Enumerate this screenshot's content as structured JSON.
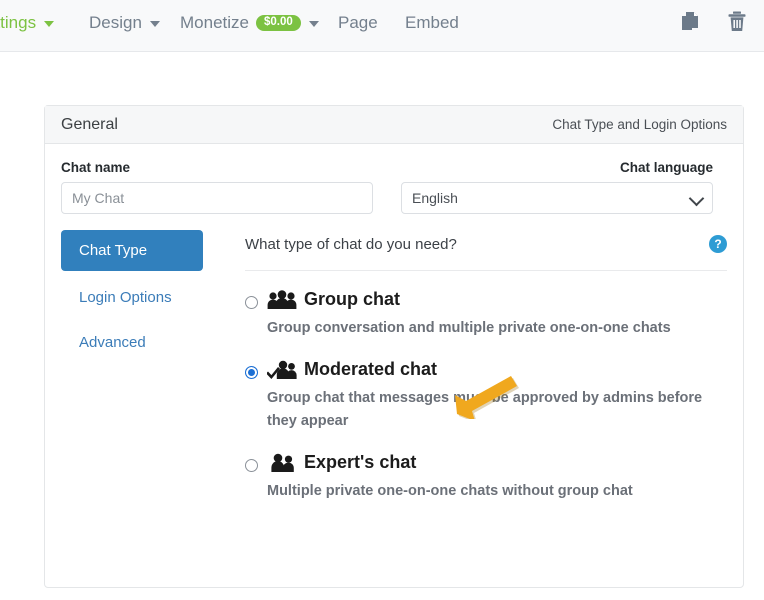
{
  "toolbar": {
    "items": [
      {
        "label": "ettings",
        "icon": "chevron-down-icon",
        "color": "#7cc242"
      },
      {
        "label": "Design",
        "icon": "chevron-down-icon",
        "color": "#74808d"
      },
      {
        "label": "Monetize",
        "badge": "$0.00",
        "badge_color": "#7cc242",
        "icon": "chevron-down-icon",
        "color": "#74808d"
      },
      {
        "label": "Page",
        "color": "#74808d"
      },
      {
        "label": "Embed",
        "color": "#74808d"
      }
    ],
    "actions": [
      {
        "name": "duplicate-icon",
        "title": "Duplicate"
      },
      {
        "name": "trash-icon",
        "title": "Delete"
      }
    ]
  },
  "card": {
    "header": {
      "title": "General",
      "subtitle": "Chat Type and Login Options"
    },
    "chat_name": {
      "label": "Chat name",
      "value": "",
      "placeholder": "My Chat"
    },
    "chat_language": {
      "label": "Chat language",
      "value": "English",
      "options": [
        "English"
      ]
    },
    "nav": {
      "items": [
        {
          "label": "Chat Type",
          "active": true
        },
        {
          "label": "Login Options",
          "active": false
        },
        {
          "label": "Advanced",
          "active": false
        }
      ]
    },
    "question": {
      "text": "What type of chat do you need?",
      "help": "?"
    },
    "options": [
      {
        "title": "Group chat",
        "description": "Group conversation and multiple private one-on-one chats",
        "selected": false,
        "icon": "group-people-icon"
      },
      {
        "title": "Moderated chat",
        "description": "Group chat that messages must be approved by admins before they appear",
        "selected": true,
        "icon": "moderated-people-check-icon"
      },
      {
        "title": "Expert's chat",
        "description": "Multiple private one-on-one chats without group chat",
        "selected": false,
        "icon": "two-people-icon"
      }
    ]
  },
  "annotation": {
    "arrow_color": "#f0a81e",
    "points_to": "Moderated chat"
  }
}
